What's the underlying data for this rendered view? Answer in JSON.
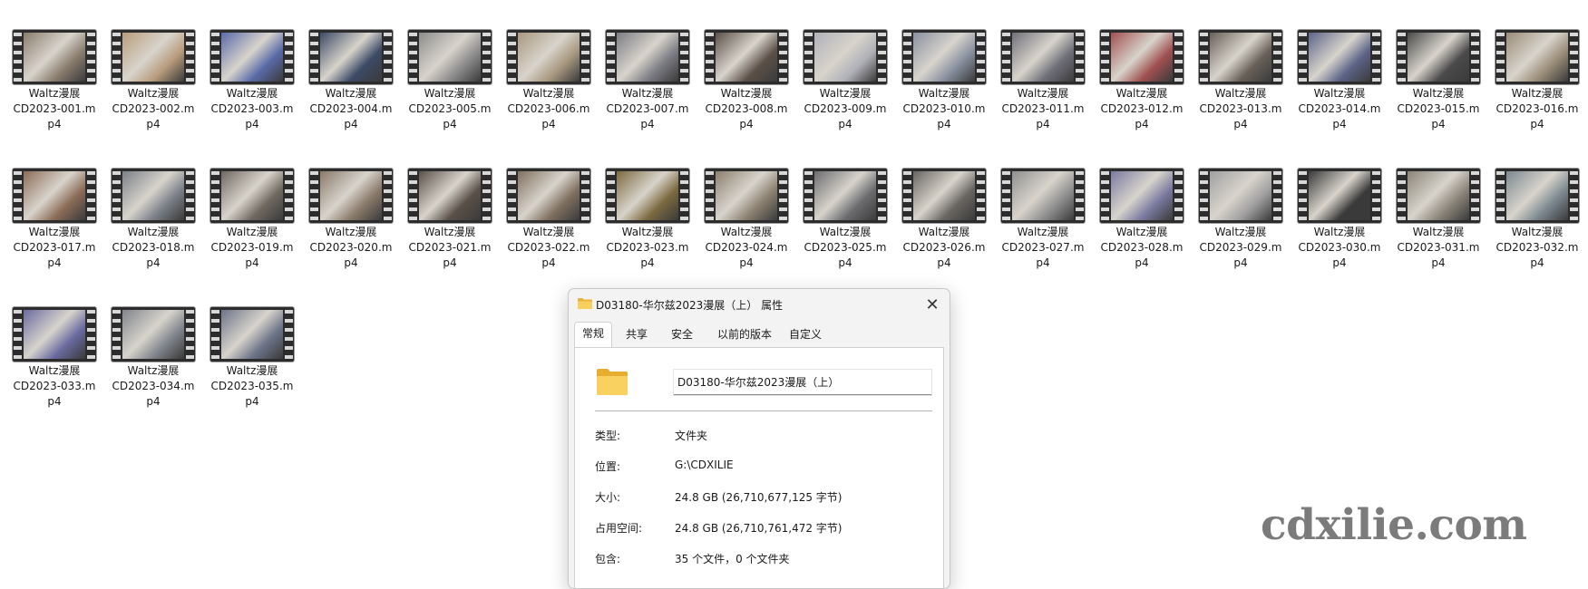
{
  "files": [
    {
      "line1": "Waltz漫展",
      "line2": "CD2023-001.m",
      "line3": "p4",
      "tone": "#8a7d6e"
    },
    {
      "line1": "Waltz漫展",
      "line2": "CD2023-002.m",
      "line3": "p4",
      "tone": "#b89c7c"
    },
    {
      "line1": "Waltz漫展",
      "line2": "CD2023-003.m",
      "line3": "p4",
      "tone": "#5a6aa8"
    },
    {
      "line1": "Waltz漫展",
      "line2": "CD2023-004.m",
      "line3": "p4",
      "tone": "#3c4a66"
    },
    {
      "line1": "Waltz漫展",
      "line2": "CD2023-005.m",
      "line3": "p4",
      "tone": "#8c8c8c"
    },
    {
      "line1": "Waltz漫展",
      "line2": "CD2023-006.m",
      "line3": "p4",
      "tone": "#a89880"
    },
    {
      "line1": "Waltz漫展",
      "line2": "CD2023-007.m",
      "line3": "p4",
      "tone": "#7c7c84"
    },
    {
      "line1": "Waltz漫展",
      "line2": "CD2023-008.m",
      "line3": "p4",
      "tone": "#5c5048"
    },
    {
      "line1": "Waltz漫展",
      "line2": "CD2023-009.m",
      "line3": "p4",
      "tone": "#b0b0b8"
    },
    {
      "line1": "Waltz漫展",
      "line2": "CD2023-010.m",
      "line3": "p4",
      "tone": "#8890a0"
    },
    {
      "line1": "Waltz漫展",
      "line2": "CD2023-011.m",
      "line3": "p4",
      "tone": "#70707a"
    },
    {
      "line1": "Waltz漫展",
      "line2": "CD2023-012.m",
      "line3": "p4",
      "tone": "#a05050"
    },
    {
      "line1": "Waltz漫展",
      "line2": "CD2023-013.m",
      "line3": "p4",
      "tone": "#686058"
    },
    {
      "line1": "Waltz漫展",
      "line2": "CD2023-014.m",
      "line3": "p4",
      "tone": "#5c6488"
    },
    {
      "line1": "Waltz漫展",
      "line2": "CD2023-015.m",
      "line3": "p4",
      "tone": "#4a4a4a"
    },
    {
      "line1": "Waltz漫展",
      "line2": "CD2023-016.m",
      "line3": "p4",
      "tone": "#9a8c78"
    },
    {
      "line1": "Waltz漫展",
      "line2": "CD2023-017.m",
      "line3": "p4",
      "tone": "#8c6c58"
    },
    {
      "line1": "Waltz漫展",
      "line2": "CD2023-018.m",
      "line3": "p4",
      "tone": "#7a8088"
    },
    {
      "line1": "Waltz漫展",
      "line2": "CD2023-019.m",
      "line3": "p4",
      "tone": "#706860"
    },
    {
      "line1": "Waltz漫展",
      "line2": "CD2023-020.m",
      "line3": "p4",
      "tone": "#8a7a6a"
    },
    {
      "line1": "Waltz漫展",
      "line2": "CD2023-021.m",
      "line3": "p4",
      "tone": "#5a5048"
    },
    {
      "line1": "Waltz漫展",
      "line2": "CD2023-022.m",
      "line3": "p4",
      "tone": "#807060"
    },
    {
      "line1": "Waltz漫展",
      "line2": "CD2023-023.m",
      "line3": "p4",
      "tone": "#7c6a40"
    },
    {
      "line1": "Waltz漫展",
      "line2": "CD2023-024.m",
      "line3": "p4",
      "tone": "#8c8070"
    },
    {
      "line1": "Waltz漫展",
      "line2": "CD2023-025.m",
      "line3": "p4",
      "tone": "#6c6c70"
    },
    {
      "line1": "Waltz漫展",
      "line2": "CD2023-026.m",
      "line3": "p4",
      "tone": "#686460"
    },
    {
      "line1": "Waltz漫展",
      "line2": "CD2023-027.m",
      "line3": "p4",
      "tone": "#909090"
    },
    {
      "line1": "Waltz漫展",
      "line2": "CD2023-028.m",
      "line3": "p4",
      "tone": "#7a7aa0"
    },
    {
      "line1": "Waltz漫展",
      "line2": "CD2023-029.m",
      "line3": "p4",
      "tone": "#a0a0a0"
    },
    {
      "line1": "Waltz漫展",
      "line2": "CD2023-030.m",
      "line3": "p4",
      "tone": "#3a3a3a"
    },
    {
      "line1": "Waltz漫展",
      "line2": "CD2023-031.m",
      "line3": "p4",
      "tone": "#8a8478"
    },
    {
      "line1": "Waltz漫展",
      "line2": "CD2023-032.m",
      "line3": "p4",
      "tone": "#7c8890"
    },
    {
      "line1": "Waltz漫展",
      "line2": "CD2023-033.m",
      "line3": "p4",
      "tone": "#6a6aa0"
    },
    {
      "line1": "Waltz漫展",
      "line2": "CD2023-034.m",
      "line3": "p4",
      "tone": "#80848c"
    },
    {
      "line1": "Waltz漫展",
      "line2": "CD2023-035.m",
      "line3": "p4",
      "tone": "#6c7488"
    }
  ],
  "dialog": {
    "title": "D03180-华尔兹2023漫展（上） 属性",
    "tabs": [
      {
        "label": "常规"
      },
      {
        "label": "共享"
      },
      {
        "label": "安全"
      },
      {
        "label": "以前的版本"
      },
      {
        "label": "自定义"
      }
    ],
    "folder_name": "D03180-华尔兹2023漫展（上）",
    "properties": [
      {
        "label": "类型:",
        "value": "文件夹"
      },
      {
        "label": "位置:",
        "value": "G:\\CDXILIE"
      },
      {
        "label": "大小:",
        "value": "24.8 GB (26,710,677,125 字节)"
      },
      {
        "label": "占用空间:",
        "value": "24.8 GB (26,710,761,472 字节)"
      },
      {
        "label": "包含:",
        "value": "35 个文件，0 个文件夹"
      }
    ],
    "folder_color": "#f5c84c"
  },
  "watermark": "cdxilie.com"
}
